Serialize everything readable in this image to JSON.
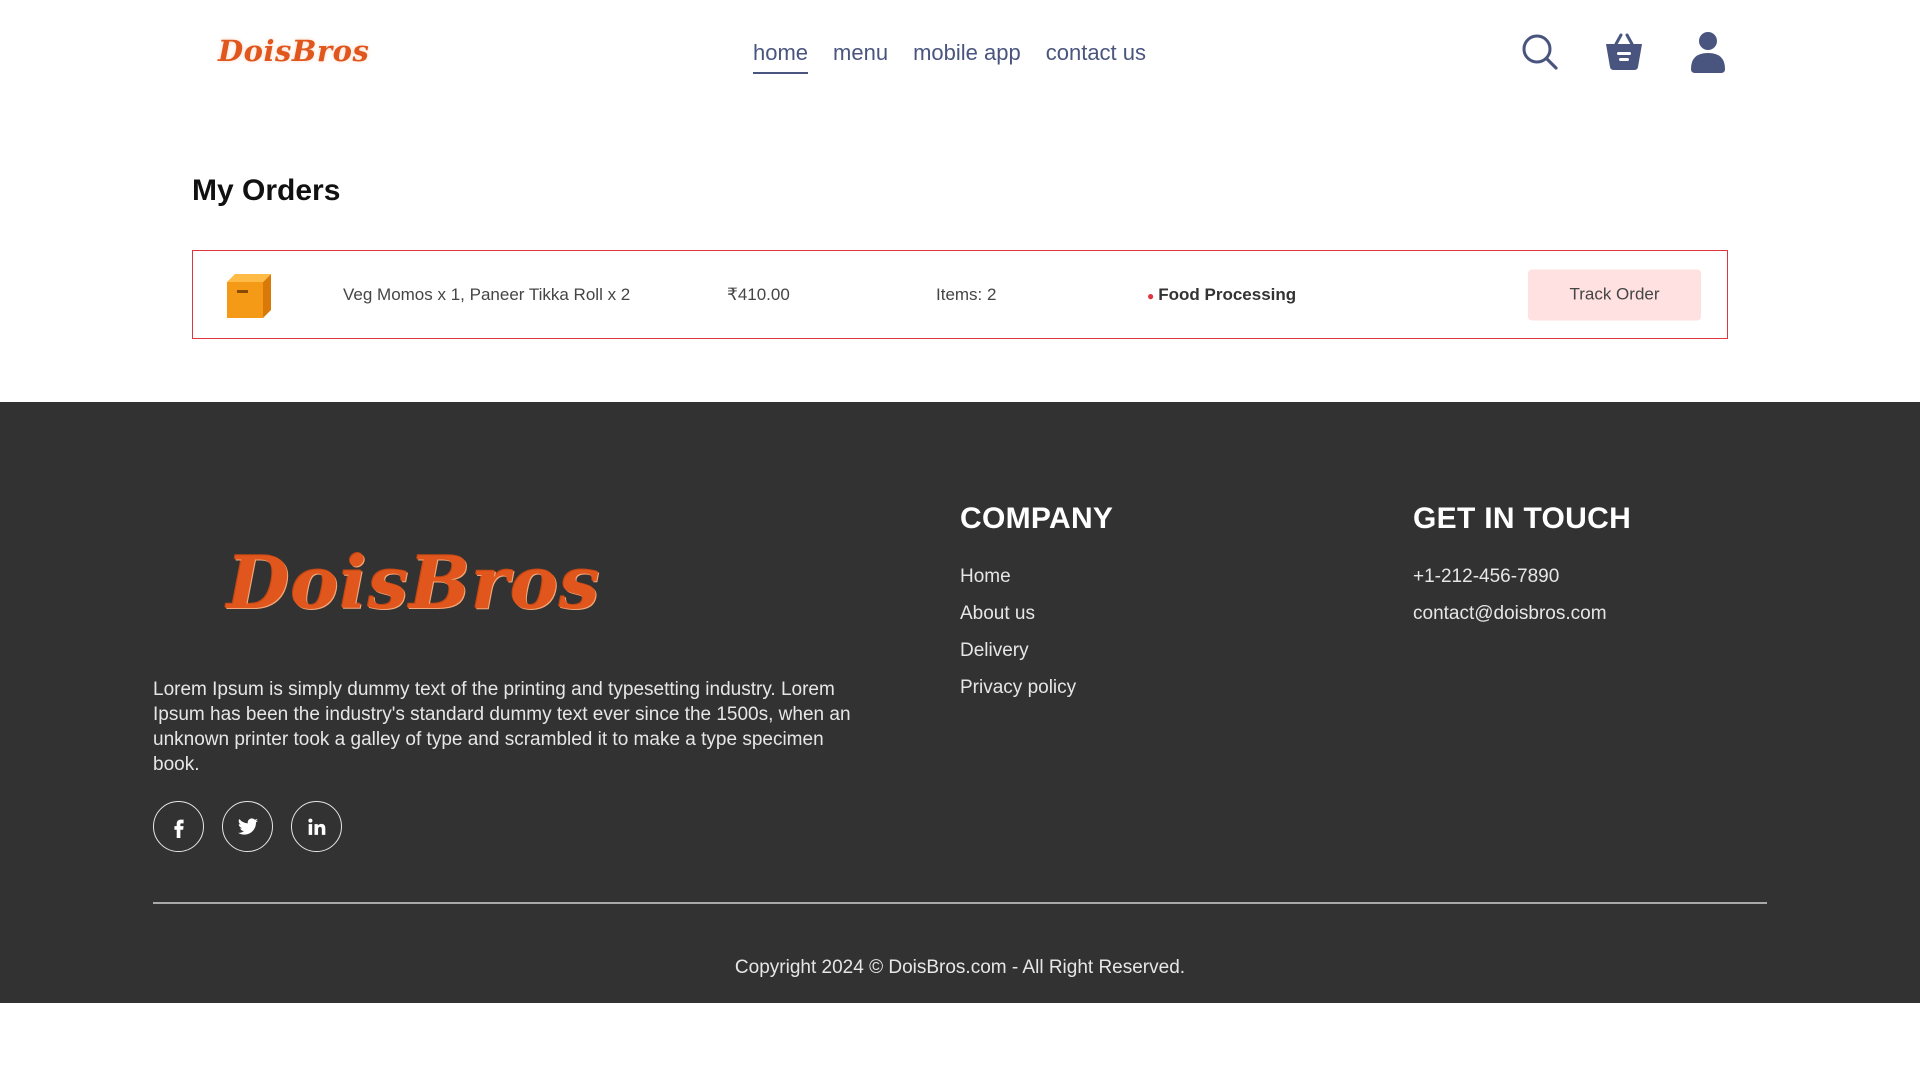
{
  "header": {
    "logo": "DoisBros",
    "nav": [
      {
        "label": "home",
        "active": true
      },
      {
        "label": "menu",
        "active": false
      },
      {
        "label": "mobile app",
        "active": false
      },
      {
        "label": "contact us",
        "active": false
      }
    ],
    "icons": [
      "search-icon",
      "basket-icon",
      "profile-icon"
    ]
  },
  "orders": {
    "title": "My Orders",
    "list": [
      {
        "items": "Veg Momos x 1, Paneer Tikka Roll x 2",
        "amount": "₹410.00",
        "count": "Items: 2",
        "status": "Food Processing",
        "status_dot": "●",
        "track_label": "Track Order"
      }
    ]
  },
  "footer": {
    "logo": "DoisBros",
    "description": "Lorem Ipsum is simply dummy text of the printing and typesetting industry. Lorem Ipsum has been the industry's standard dummy text ever since the 1500s, when an unknown printer took a galley of type and scrambled it to make a type specimen book.",
    "socials": [
      "facebook-icon",
      "twitter-icon",
      "linkedin-icon"
    ],
    "company": {
      "heading": "COMPANY",
      "links": [
        "Home",
        "About us",
        "Delivery",
        "Privacy policy"
      ]
    },
    "touch": {
      "heading": "GET IN TOUCH",
      "phone": "+1-212-456-7890",
      "email": "contact@doisbros.com"
    },
    "copyright": "Copyright 2024 © DoisBros.com - All Right Reserved."
  },
  "colors": {
    "brand": "#e0561c",
    "nav": "#49557e",
    "card_border": "#e0353f",
    "track_button": "#ffe1e1",
    "footer_bg": "#323232"
  }
}
